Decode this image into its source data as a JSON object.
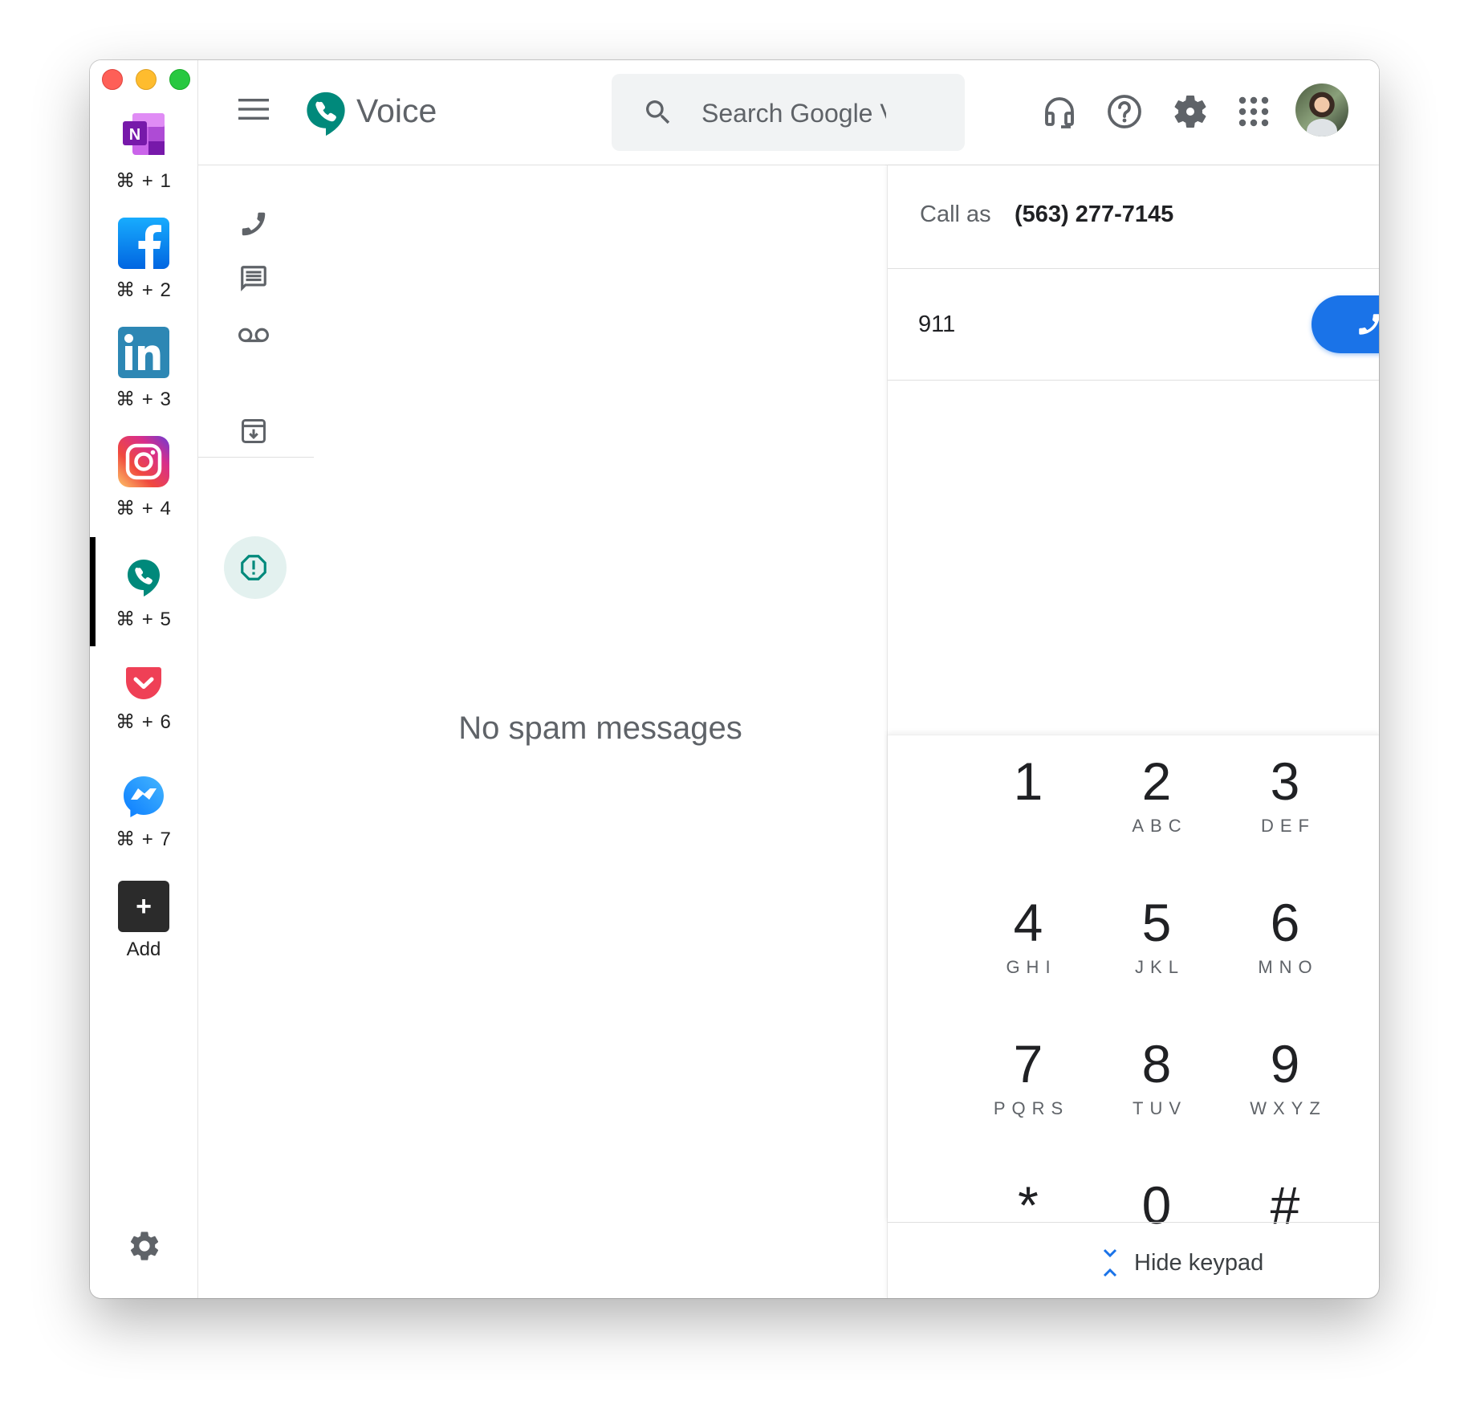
{
  "window": {
    "traffic_lights": [
      "close",
      "minimize",
      "zoom"
    ]
  },
  "switcher": {
    "apps": [
      {
        "name": "OneNote",
        "shortcut": "⌘ + 1",
        "icon": "onenote-icon"
      },
      {
        "name": "Facebook",
        "shortcut": "⌘ + 2",
        "icon": "facebook-icon"
      },
      {
        "name": "LinkedIn",
        "shortcut": "⌘ + 3",
        "icon": "linkedin-icon"
      },
      {
        "name": "Instagram",
        "shortcut": "⌘ + 4",
        "icon": "instagram-icon"
      },
      {
        "name": "Google Voice",
        "shortcut": "⌘ + 5",
        "icon": "voice-icon",
        "active": true
      },
      {
        "name": "Pocket",
        "shortcut": "⌘ + 6",
        "icon": "pocket-icon"
      },
      {
        "name": "Messenger",
        "shortcut": "⌘ + 7",
        "icon": "messenger-icon"
      }
    ],
    "add_label": "Add",
    "add_symbol": "+"
  },
  "header": {
    "app_title": "Voice",
    "search_placeholder": "Search Google Voice",
    "icons": [
      "menu-icon",
      "headset-icon",
      "help-icon",
      "settings-icon",
      "apps-grid-icon",
      "avatar"
    ]
  },
  "nav": {
    "items": [
      "calls",
      "messages",
      "voicemail",
      "archive",
      "spam"
    ],
    "active": "spam"
  },
  "center": {
    "empty_message": "No spam messages"
  },
  "dialer": {
    "call_as_label": "Call as",
    "call_as_number": "(563) 277-7145",
    "dialed_number": "911",
    "keys": [
      {
        "digit": "1",
        "letters": ""
      },
      {
        "digit": "2",
        "letters": "ABC"
      },
      {
        "digit": "3",
        "letters": "DEF"
      },
      {
        "digit": "4",
        "letters": "GHI"
      },
      {
        "digit": "5",
        "letters": "JKL"
      },
      {
        "digit": "6",
        "letters": "MNO"
      },
      {
        "digit": "7",
        "letters": "PQRS"
      },
      {
        "digit": "8",
        "letters": "TUV"
      },
      {
        "digit": "9",
        "letters": "WXYZ"
      },
      {
        "digit": "*",
        "letters": ""
      },
      {
        "digit": "0",
        "letters": ""
      },
      {
        "digit": "#",
        "letters": ""
      }
    ],
    "hide_keypad_label": "Hide keypad"
  },
  "colors": {
    "voice_green": "#00897b",
    "call_blue": "#1a73e8",
    "spam_active_bg": "#e3f1ef",
    "icon_gray": "#5f6368"
  }
}
